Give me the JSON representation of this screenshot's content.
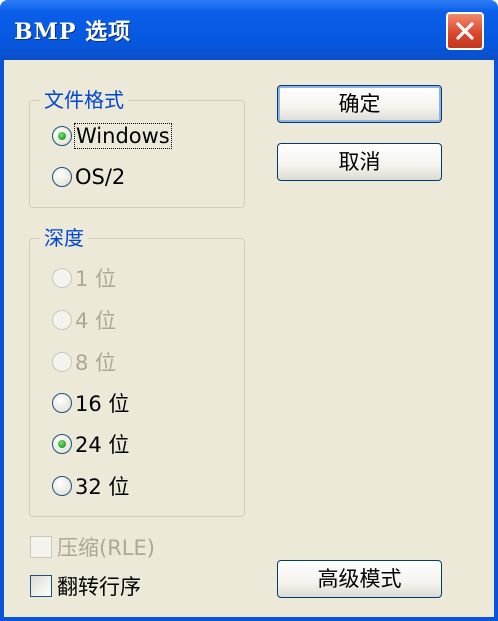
{
  "window": {
    "title": "BMP 选项"
  },
  "buttons": {
    "ok": "确定",
    "cancel": "取消",
    "advanced": "高级模式"
  },
  "file_format": {
    "title": "文件格式",
    "options": [
      {
        "label": "Windows",
        "checked": true,
        "disabled": false
      },
      {
        "label": "OS/2",
        "checked": false,
        "disabled": false
      }
    ]
  },
  "depth": {
    "title": "深度",
    "options": [
      {
        "label": "1 位",
        "checked": false,
        "disabled": true
      },
      {
        "label": "4 位",
        "checked": false,
        "disabled": true
      },
      {
        "label": "8 位",
        "checked": false,
        "disabled": true
      },
      {
        "label": "16 位",
        "checked": false,
        "disabled": false
      },
      {
        "label": "24 位",
        "checked": true,
        "disabled": false
      },
      {
        "label": "32 位",
        "checked": false,
        "disabled": false
      }
    ]
  },
  "checkboxes": {
    "compress": {
      "label": "压缩(RLE)",
      "checked": false,
      "disabled": true
    },
    "flip": {
      "label": "翻转行序",
      "checked": false,
      "disabled": false
    }
  },
  "icons": {
    "close": "close-icon"
  },
  "colors": {
    "titlebar": "#0758e0",
    "client": "#ece9d8",
    "group_title": "#0046d5",
    "close_button": "#d8452a"
  }
}
